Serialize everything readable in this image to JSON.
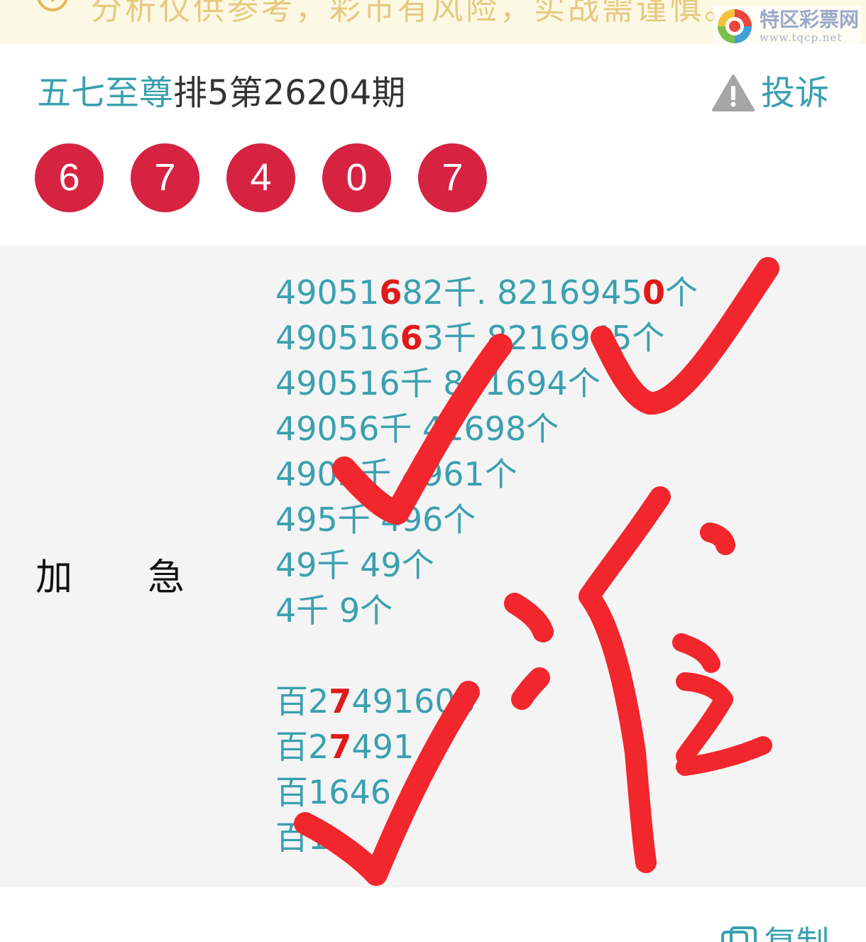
{
  "banner": {
    "text": "分析仅供参考，彩市有风险，实战需谨慎。",
    "watermark_name": "特区彩票网",
    "watermark_url": "www.tqcp.net"
  },
  "header": {
    "author": "五七至尊",
    "issue": "排5第26204期",
    "report_label": "投诉"
  },
  "draw_numbers": [
    "6",
    "7",
    "4",
    "0",
    "7"
  ],
  "prediction": {
    "label_chars": [
      "加",
      "急"
    ],
    "lines": [
      [
        {
          "t": "49051"
        },
        {
          "t": "6",
          "hl": true
        },
        {
          "t": "82千. 8216945"
        },
        {
          "t": "0",
          "hl": true
        },
        {
          "t": "个"
        }
      ],
      [
        {
          "t": "490516"
        },
        {
          "t": "6",
          "hl": true,
          "replace": true
        },
        {
          "t": "3千 8216945个"
        }
      ],
      [
        {
          "t": "490516千 821694个"
        }
      ],
      [
        {
          "t": "49056千 41698个"
        }
      ],
      [
        {
          "t": "4905千 4961个"
        }
      ],
      [
        {
          "t": "495千 496个"
        }
      ],
      [
        {
          "t": "49千 49个"
        }
      ],
      [
        {
          "t": "4千 9个"
        }
      ],
      [],
      [
        {
          "t": "百2"
        },
        {
          "t": "7",
          "hl": true
        },
        {
          "t": "491605"
        }
      ],
      [
        {
          "t": "百2"
        },
        {
          "t": "7",
          "hl": true
        },
        {
          "t": "491"
        }
      ],
      [
        {
          "t": "百1646"
        }
      ],
      [
        {
          "t": "百1"
        }
      ]
    ]
  },
  "footer": {
    "copy_label": "复制"
  },
  "colors": {
    "accent": "#3aa0b0",
    "ball": "#d62342",
    "highlight": "#e01a1a",
    "panel_bg": "#f4f4f4",
    "banner_bg": "#fdf8e4",
    "annotation": "#f2262d"
  }
}
